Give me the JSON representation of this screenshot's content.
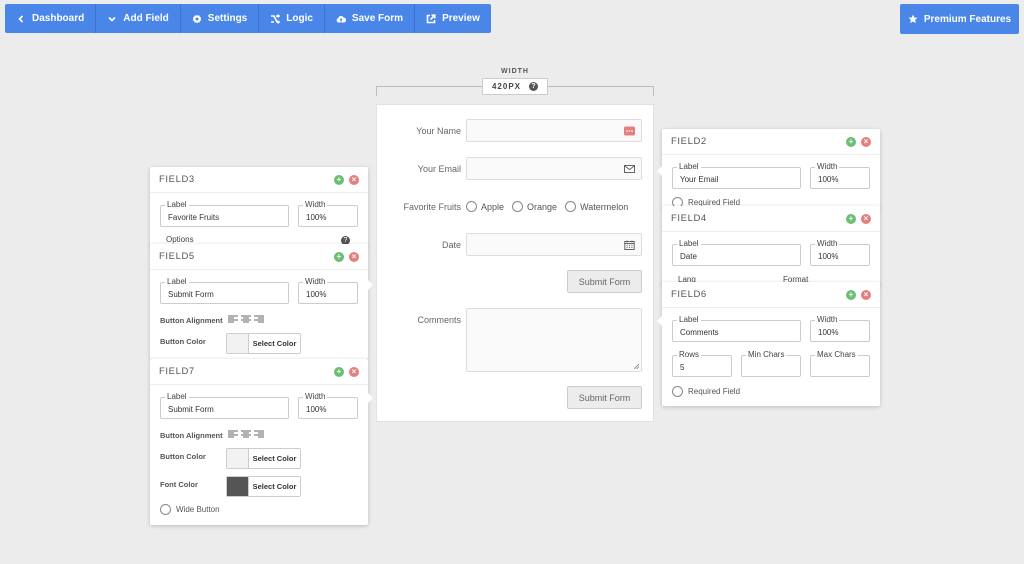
{
  "toolbar": {
    "dashboard": "Dashboard",
    "add_field": "Add Field",
    "settings": "Settings",
    "logic": "Logic",
    "save_form": "Save Form",
    "preview": "Preview"
  },
  "premium": "Premium Features",
  "width_indicator": {
    "label": "WIDTH",
    "value": "420PX",
    "help": "?"
  },
  "form": {
    "your_name": "Your Name",
    "your_email": "Your Email",
    "favorite_fruits": "Favorite Fruits",
    "fruits": [
      "Apple",
      "Orange",
      "Watermelon"
    ],
    "date": "Date",
    "submit1": "Submit Form",
    "comments": "Comments",
    "submit2": "Submit Form"
  },
  "field3": {
    "title": "FIELD3",
    "label_cap": "Label",
    "label_val": "Favorite Fruits",
    "width_cap": "Width",
    "width_val": "100%",
    "options": "Options"
  },
  "field5": {
    "title": "FIELD5",
    "label_cap": "Label",
    "label_val": "Submit Form",
    "width_cap": "Width",
    "width_val": "100%",
    "btn_align": "Button Alignment",
    "btn_color": "Button Color",
    "select_color": "Select Color"
  },
  "field7": {
    "title": "FIELD7",
    "label_cap": "Label",
    "label_val": "Submit Form",
    "width_cap": "Width",
    "width_val": "100%",
    "btn_align": "Button Alignment",
    "btn_color": "Button Color",
    "font_color": "Font Color",
    "select_color": "Select Color",
    "wide_button": "Wide Button"
  },
  "field2": {
    "title": "FIELD2",
    "label_cap": "Label",
    "label_val": "Your Email",
    "width_cap": "Width",
    "width_val": "100%",
    "required": "Required Field"
  },
  "field4": {
    "title": "FIELD4",
    "label_cap": "Label",
    "label_val": "Date",
    "width_cap": "Width",
    "width_val": "100%",
    "lang": "Lang",
    "format": "Format"
  },
  "field6": {
    "title": "FIELD6",
    "label_cap": "Label",
    "label_val": "Comments",
    "width_cap": "Width",
    "width_val": "100%",
    "rows_cap": "Rows",
    "rows_val": "5",
    "min_cap": "Min Chars",
    "max_cap": "Max Chars",
    "required": "Required Field"
  },
  "colors": {
    "accent": "#4a86e8",
    "add": "#6bbf72",
    "delete": "#e57f7f",
    "font_swatch": "#555555"
  }
}
